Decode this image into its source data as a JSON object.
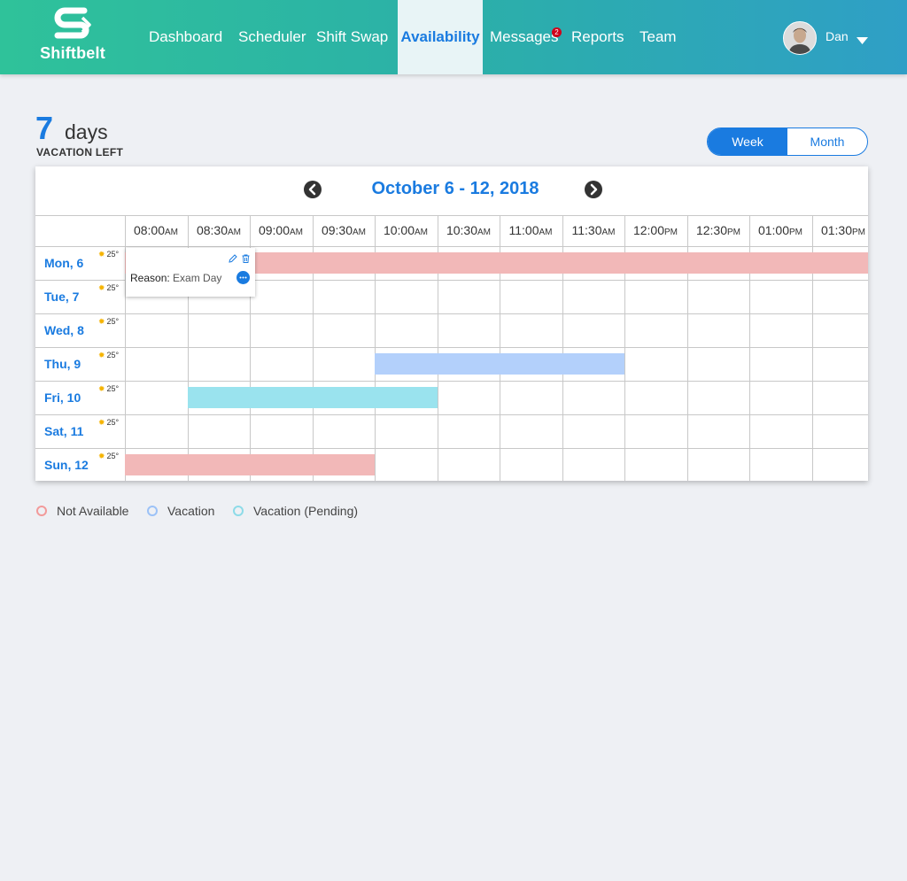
{
  "app": {
    "brand": "Shiftbelt"
  },
  "nav": {
    "items": [
      {
        "label": "Dashboard",
        "active": false
      },
      {
        "label": "Scheduler",
        "active": false
      },
      {
        "label": "Shift Swap",
        "active": false
      },
      {
        "label": "Availability",
        "active": true
      },
      {
        "label": "Messages",
        "active": false,
        "badge": "2"
      },
      {
        "label": "Reports",
        "active": false
      },
      {
        "label": "Team",
        "active": false
      }
    ]
  },
  "user": {
    "name": "Dan",
    "avatar_icon": "user-avatar",
    "menu_icon": "caret-down-icon"
  },
  "vacation": {
    "count": "7",
    "unit": "days",
    "label": "VACATION LEFT"
  },
  "view_toggle": {
    "options": [
      "Week",
      "Month"
    ],
    "selected": "Week"
  },
  "calendar": {
    "range_title": "October 6 - 12, 2018",
    "prev_icon": "chevron-left-icon",
    "next_icon": "chevron-right-icon",
    "times": [
      {
        "t": "08:00",
        "p": "AM"
      },
      {
        "t": "08:30",
        "p": "AM"
      },
      {
        "t": "09:00",
        "p": "AM"
      },
      {
        "t": "09:30",
        "p": "AM"
      },
      {
        "t": "10:00",
        "p": "AM"
      },
      {
        "t": "10:30",
        "p": "AM"
      },
      {
        "t": "11:00",
        "p": "AM"
      },
      {
        "t": "11:30",
        "p": "AM"
      },
      {
        "t": "12:00",
        "p": "PM"
      },
      {
        "t": "12:30",
        "p": "PM"
      },
      {
        "t": "01:00",
        "p": "PM"
      },
      {
        "t": "01:30",
        "p": "PM"
      }
    ],
    "days": [
      {
        "label": "Mon, 6",
        "temp": "25°"
      },
      {
        "label": "Tue, 7",
        "temp": "25°"
      },
      {
        "label": "Wed, 8",
        "temp": "25°"
      },
      {
        "label": "Thu, 9",
        "temp": "25°"
      },
      {
        "label": "Fri, 10",
        "temp": "25°"
      },
      {
        "label": "Sat, 11",
        "temp": "25°"
      },
      {
        "label": "Sun, 12",
        "temp": "25°"
      }
    ],
    "weather_icon": "sun-icon",
    "entries": [
      {
        "day": "Mon, 6",
        "type": "not_available",
        "start": "08:00 AM",
        "end": "02:00 PM"
      },
      {
        "day": "Thu, 9",
        "type": "vacation",
        "start": "10:00 AM",
        "end": "12:00 PM"
      },
      {
        "day": "Fri, 10",
        "type": "vacation_pending",
        "start": "08:30 AM",
        "end": "10:30 AM"
      },
      {
        "day": "Sun, 12",
        "type": "not_available",
        "start": "08:00 AM",
        "end": "10:00 AM"
      }
    ],
    "popover": {
      "reason_label": "Reason:",
      "reason_value": "Exam Day",
      "edit_icon": "pencil-icon",
      "delete_icon": "trash-icon",
      "comment_icon": "chat-bubble-icon"
    }
  },
  "legend": [
    {
      "key": "not_available",
      "label": "Not Available",
      "color": "#f2b8b8",
      "ring": "#f29a9a"
    },
    {
      "key": "vacation",
      "label": "Vacation",
      "color": "#b3d0fb",
      "ring": "#9cc2f7"
    },
    {
      "key": "vacation_pending",
      "label": "Vacation (Pending)",
      "color": "#9ae3ee",
      "ring": "#8ddbe8"
    }
  ],
  "colors": {
    "accent": "#1a7be0",
    "badge": "#d0021b"
  }
}
